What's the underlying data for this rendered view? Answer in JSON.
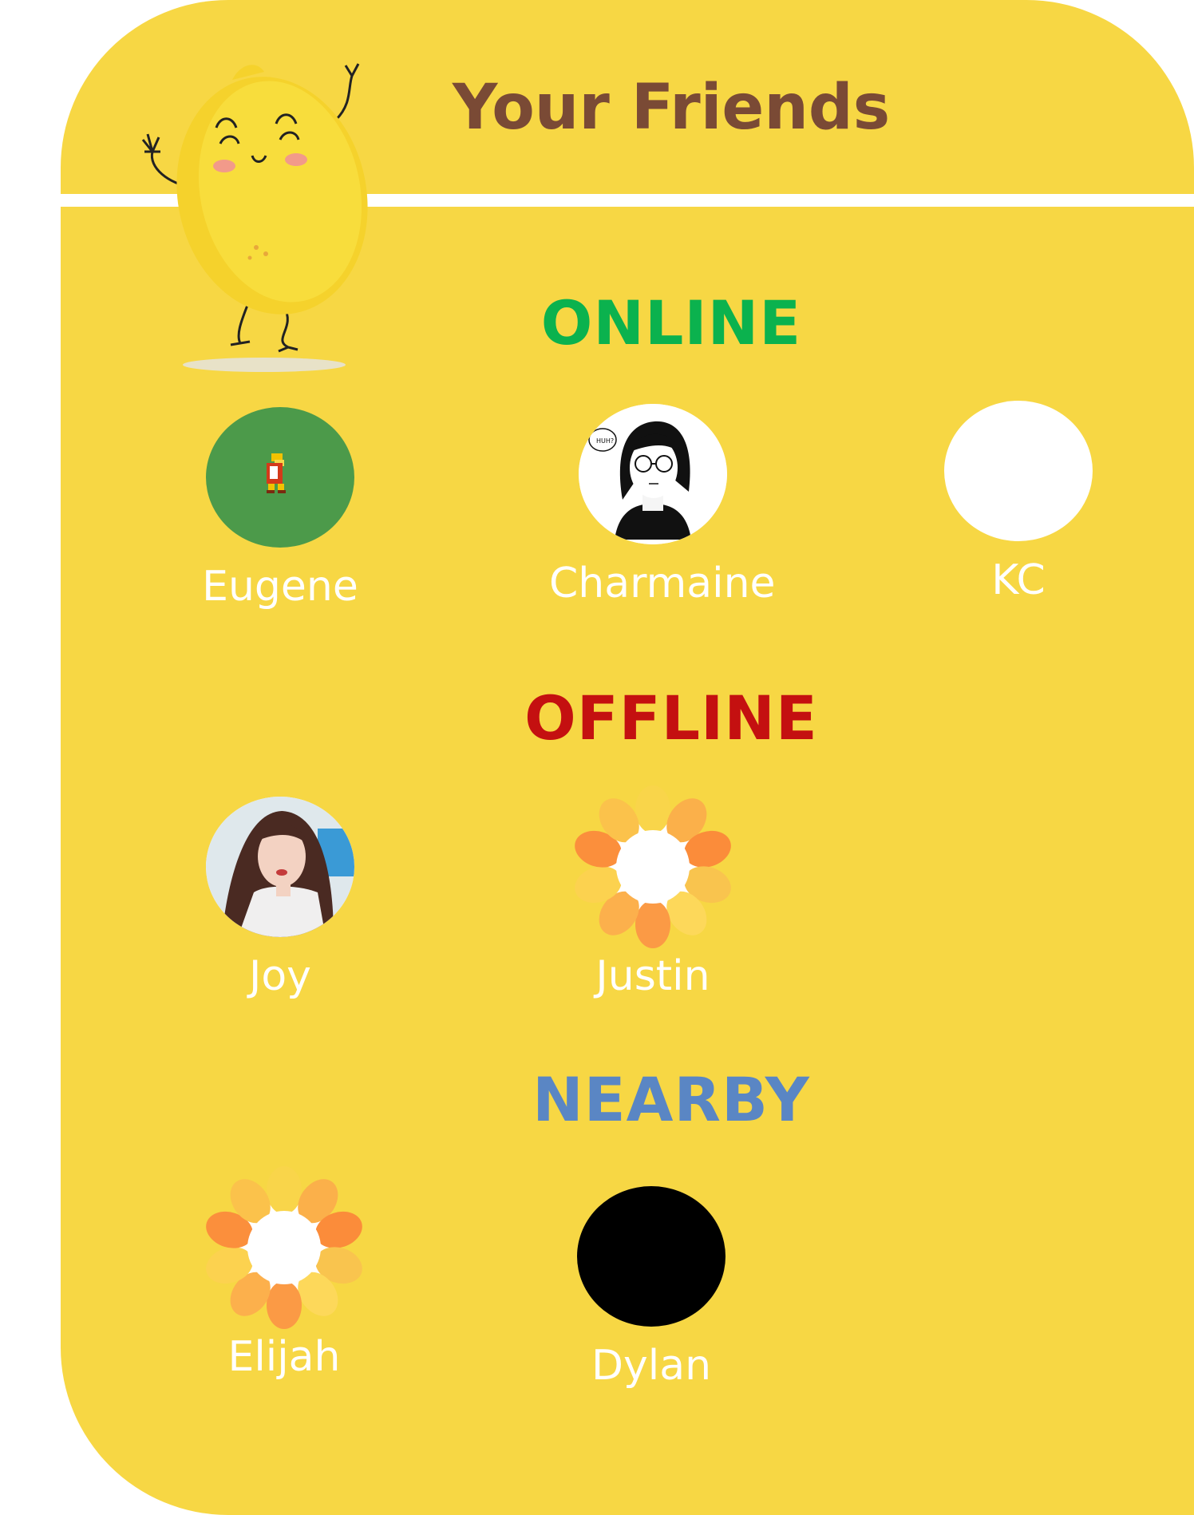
{
  "header": {
    "title": "Your Friends"
  },
  "colors": {
    "panel": "#f7d744",
    "title": "#7a4a35",
    "online": "#0bb24e",
    "offline": "#c41010",
    "nearby": "#5a86c4",
    "name": "#ffffff"
  },
  "mascot": {
    "icon": "lemon-mascot-icon"
  },
  "sections": {
    "online": {
      "label": "ONLINE",
      "friends": [
        {
          "name": "Eugene",
          "avatar": "pixel-turtle-avatar"
        },
        {
          "name": "Charmaine",
          "avatar": "manga-girl-avatar"
        },
        {
          "name": "KC",
          "avatar": "blank-white-avatar"
        }
      ]
    },
    "offline": {
      "label": "OFFLINE",
      "friends": [
        {
          "name": "Joy",
          "avatar": "photo-avatar"
        },
        {
          "name": "Justin",
          "avatar": "orange-flower-avatar"
        }
      ]
    },
    "nearby": {
      "label": "NEARBY",
      "friends": [
        {
          "name": "Elijah",
          "avatar": "orange-flower-avatar"
        },
        {
          "name": "Dylan",
          "avatar": "black-avatar"
        }
      ]
    }
  }
}
